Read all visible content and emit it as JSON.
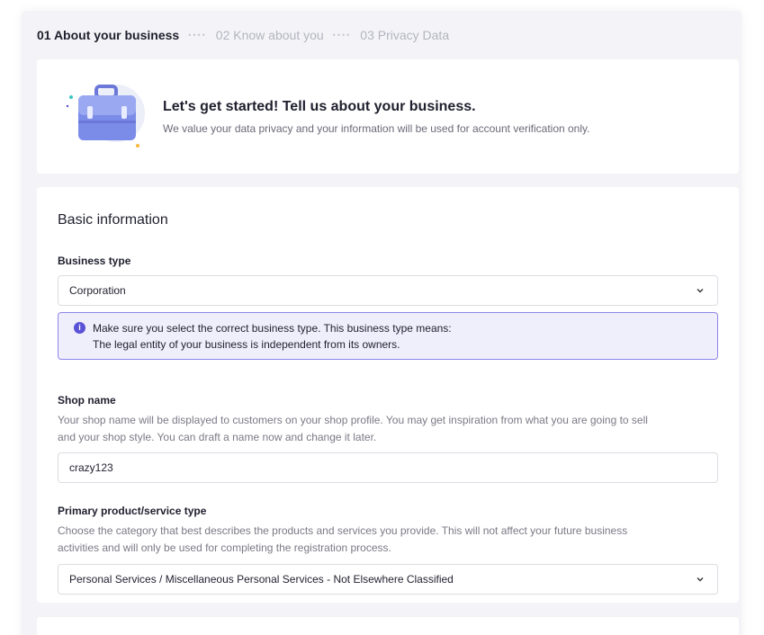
{
  "stepper": {
    "steps": [
      {
        "label": "01 About your business",
        "state": "active"
      },
      {
        "label": "02 Know about you",
        "state": "inactive"
      },
      {
        "label": "03 Privacy Data",
        "state": "inactive"
      }
    ]
  },
  "intro": {
    "title": "Let's get started! Tell us about your business.",
    "subtitle": "We value your data privacy and your information will be used for account verification only.",
    "icon": "briefcase-icon"
  },
  "basic_info": {
    "section_title": "Basic information",
    "business_type": {
      "label": "Business type",
      "value": "Corporation",
      "notice_line1": "Make sure you select the correct business type. This business type means:",
      "notice_line2": "The legal entity of your business is independent from its owners."
    },
    "shop_name": {
      "label": "Shop name",
      "help_line1": "Your shop name will be displayed to customers on your shop profile. You may get inspiration from what you are going to sell",
      "help_line2": "and your shop style. You can draft a name now and change it later.",
      "value": "crazy123"
    },
    "primary_type": {
      "label": "Primary product/service type",
      "help_line1": "Choose the category that best describes the products and services you provide. This will not affect your future business",
      "help_line2": "activities and will only be used for completing the registration process.",
      "value": "Personal Services / Miscellaneous Personal Services - Not Elsewhere Classified"
    }
  },
  "colors": {
    "accent": "#5a52d6",
    "notice_bg": "#efeffc",
    "notice_border": "#8b86ea",
    "page_bg": "#f4f4f8"
  }
}
